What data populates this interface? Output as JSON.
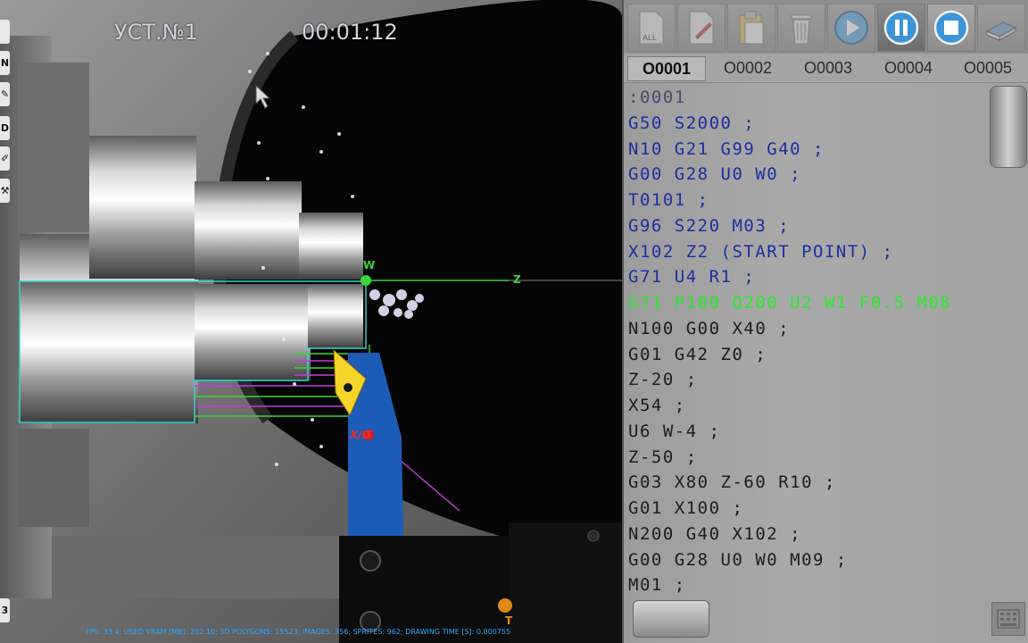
{
  "simulation": {
    "setup_label": "УСТ.№1",
    "timer": "00:01:12",
    "fps_line": "FPS: 33.4; USED VRAM [MB]: 202.10; 3D POLYGONS: 15523; IMAGES: 356; SPRITES: 962; DRAWING TIME [S]: 0.000755",
    "axis_w": "W",
    "axis_z": "Z",
    "axis_x": "X/Ø",
    "axis_t": "T",
    "side_buttons": [
      "",
      "N",
      "",
      "D",
      "",
      "",
      "3"
    ]
  },
  "toolbar": {
    "buttons": [
      {
        "icon": "all-files-icon",
        "label": "ALL",
        "enabled": false
      },
      {
        "icon": "edit-file-icon",
        "enabled": false
      },
      {
        "icon": "paste-icon",
        "enabled": false
      },
      {
        "icon": "trash-icon",
        "enabled": false
      },
      {
        "icon": "play-icon",
        "enabled": false
      },
      {
        "icon": "pause-icon",
        "enabled": true
      },
      {
        "icon": "stop-icon",
        "enabled": true
      },
      {
        "icon": "book-icon",
        "enabled": false
      }
    ]
  },
  "program_tabs": [
    {
      "label": "O0001",
      "active": true
    },
    {
      "label": "O0002",
      "active": false
    },
    {
      "label": "O0003",
      "active": false
    },
    {
      "label": "O0004",
      "active": false
    },
    {
      "label": "O0005",
      "active": false
    }
  ],
  "code_lines": [
    ":0001",
    "G50 S2000 ;",
    "N10 G21 G99 G40 ;",
    "G00 G28 U0 W0 ;",
    "T0101 ;",
    "G96 S220 M03 ;",
    "X102 Z2 (START POINT) ;",
    "G71 U4 R1 ;",
    "G71 P100 Q200 U2 W1 F0.5 M08",
    "N100 G00 X40 ;",
    "G01 G42 Z0 ;",
    "Z-20 ;",
    "X54 ;",
    "U6 W-4 ;",
    "Z-50 ;",
    "G03 X80 Z-60 R10 ;",
    "G01 X100 ;",
    "N200 G40 X102 ;",
    "G00 G28 U0 W0 M09 ;",
    "M01 ;"
  ],
  "current_line_index": 8,
  "colors": {
    "code_blue": "#1d2f9e",
    "current_line_green": "#2ce82c",
    "toolpath_cyan": "#35d6d6",
    "toolpath_magenta": "#c23bd8",
    "toolpath_green": "#3bd63b",
    "tool_holder_blue": "#1c5bb8",
    "insert_yellow": "#f5d52a"
  }
}
